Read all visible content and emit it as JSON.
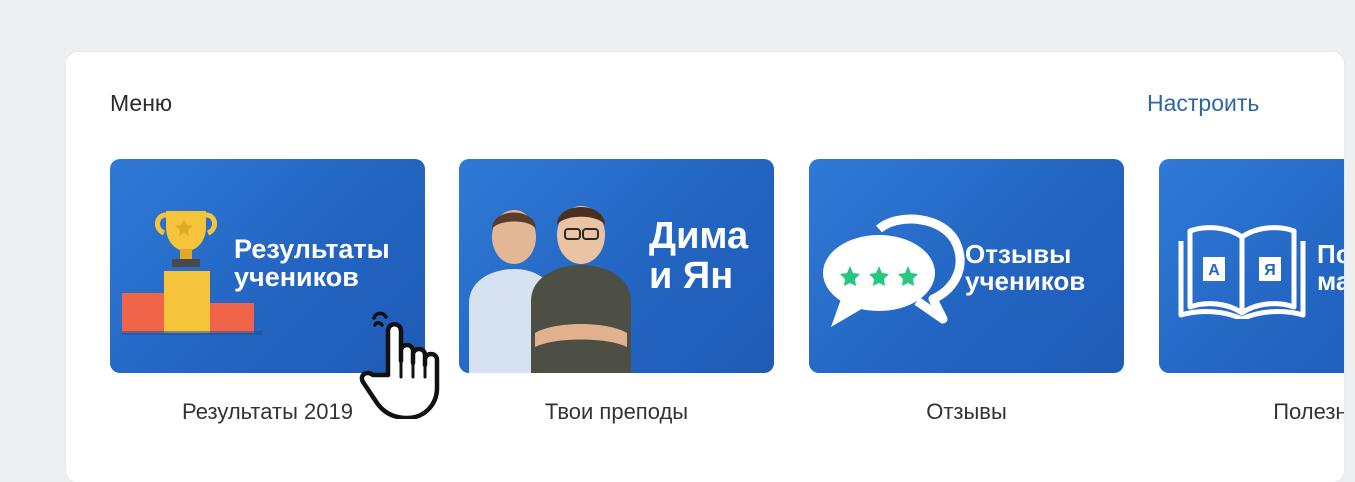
{
  "menu": {
    "title": "Меню",
    "configure_label": "Настроить"
  },
  "tiles": [
    {
      "banner_line1": "Результаты",
      "banner_line2": "учеников",
      "caption": "Результаты 2019",
      "icon": "trophy-podium-icon"
    },
    {
      "banner_line1": "Дима",
      "banner_line2": "и Ян",
      "caption": "Твои преподы",
      "icon": "teachers-photo"
    },
    {
      "banner_line1": "Отзывы",
      "banner_line2": "учеников",
      "caption": "Отзывы",
      "icon": "speech-bubble-stars-icon"
    },
    {
      "banner_line1": "По",
      "banner_line2": "ма",
      "caption": "Полезно",
      "icon": "open-book-icon"
    }
  ],
  "colors": {
    "banner_blue": "#2668c4",
    "link": "#2f66a8",
    "gold": "#f5c43b",
    "podium_red": "#f0644a",
    "star_green": "#26c77f"
  }
}
